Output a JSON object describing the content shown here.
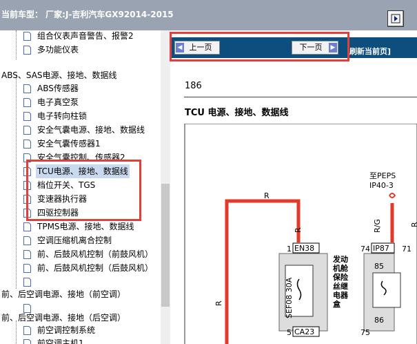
{
  "header": {
    "title": "当前车型： 厂家:J-吉利汽车GX92014-2015",
    "nav_icon": "exit-arrow-icon"
  },
  "tree": {
    "items": [
      {
        "label": "组合仪表声音警告、报警2",
        "indent": 1,
        "selected": false
      },
      {
        "label": "多功能仪表",
        "indent": 1,
        "selected": false
      },
      {
        "label": "ABS、SAS电源、接地、数据线",
        "indent": 0,
        "selected": false
      },
      {
        "label": "ABS传感器",
        "indent": 1,
        "selected": false
      },
      {
        "label": "电子真空泵",
        "indent": 1,
        "selected": false
      },
      {
        "label": "电子转向柱锁",
        "indent": 1,
        "selected": false
      },
      {
        "label": "安全气囊电源、接地、数据线",
        "indent": 1,
        "selected": false
      },
      {
        "label": "安全气囊传感器1",
        "indent": 1,
        "selected": false
      },
      {
        "label": "安全气囊控制、传感器2",
        "indent": 1,
        "selected": false
      },
      {
        "label": "TCU电源、接地、数据线",
        "indent": 1,
        "selected": true
      },
      {
        "label": "档位开关、TGS",
        "indent": 1,
        "selected": false
      },
      {
        "label": "变速器执行器",
        "indent": 1,
        "selected": false
      },
      {
        "label": "四驱控制器",
        "indent": 1,
        "selected": false
      },
      {
        "label": "TPMS电源、接地、数据线",
        "indent": 1,
        "selected": false
      },
      {
        "label": "空调压缩机离合控制",
        "indent": 1,
        "selected": false
      },
      {
        "label": "前、后鼓风机控制（前鼓风机）",
        "indent": 1,
        "selected": false
      },
      {
        "label": "前、后鼓风机控制（后鼓风机）",
        "indent": 1,
        "selected": false
      },
      {
        "label": "",
        "indent": 1,
        "selected": false
      },
      {
        "label": "前、后空调电源、接地（前空调）",
        "indent": 0,
        "selected": false
      },
      {
        "label": "",
        "indent": 1,
        "selected": false
      },
      {
        "label": "前、后空调电源、接地（后空调）",
        "indent": 0,
        "selected": false
      },
      {
        "label": "前空调控制系统",
        "indent": 1,
        "selected": false
      },
      {
        "label": "前空调主机1",
        "indent": 1,
        "selected": false
      }
    ]
  },
  "toolbar": {
    "prev_label": "上一页",
    "next_label": "下一页",
    "refresh_label": "刷新当前页]"
  },
  "document": {
    "page_number": "186",
    "title": "TCU 电源、接地、数据线",
    "labels": {
      "wire_r_top": "R",
      "wire_r_vertical": "R",
      "wire_r_left": "R",
      "wire_rg": "R/G",
      "wire_r_right": "R",
      "peps": "至PEPS",
      "peps_pin": "IP40-3",
      "pin_1": "1",
      "conn_en38": "EN38",
      "pin_74": "74",
      "conn_ip87": "IP87",
      "pin_71": "71",
      "pin_57": "57",
      "conn_ca23": "CA23",
      "pin_75": "75",
      "pin_85": "85",
      "pin_86": "86",
      "fuse": "SEF08 30A",
      "relay_box": "发动机舱保险丝继电器盒"
    }
  },
  "colors": {
    "header_bg": "#9aa3b1",
    "nav_strip_bg": "#0e4e7e",
    "highlight_box": "#e0403c",
    "wire_red": "#e23a2a",
    "selection_bg": "#c9d9ef"
  }
}
